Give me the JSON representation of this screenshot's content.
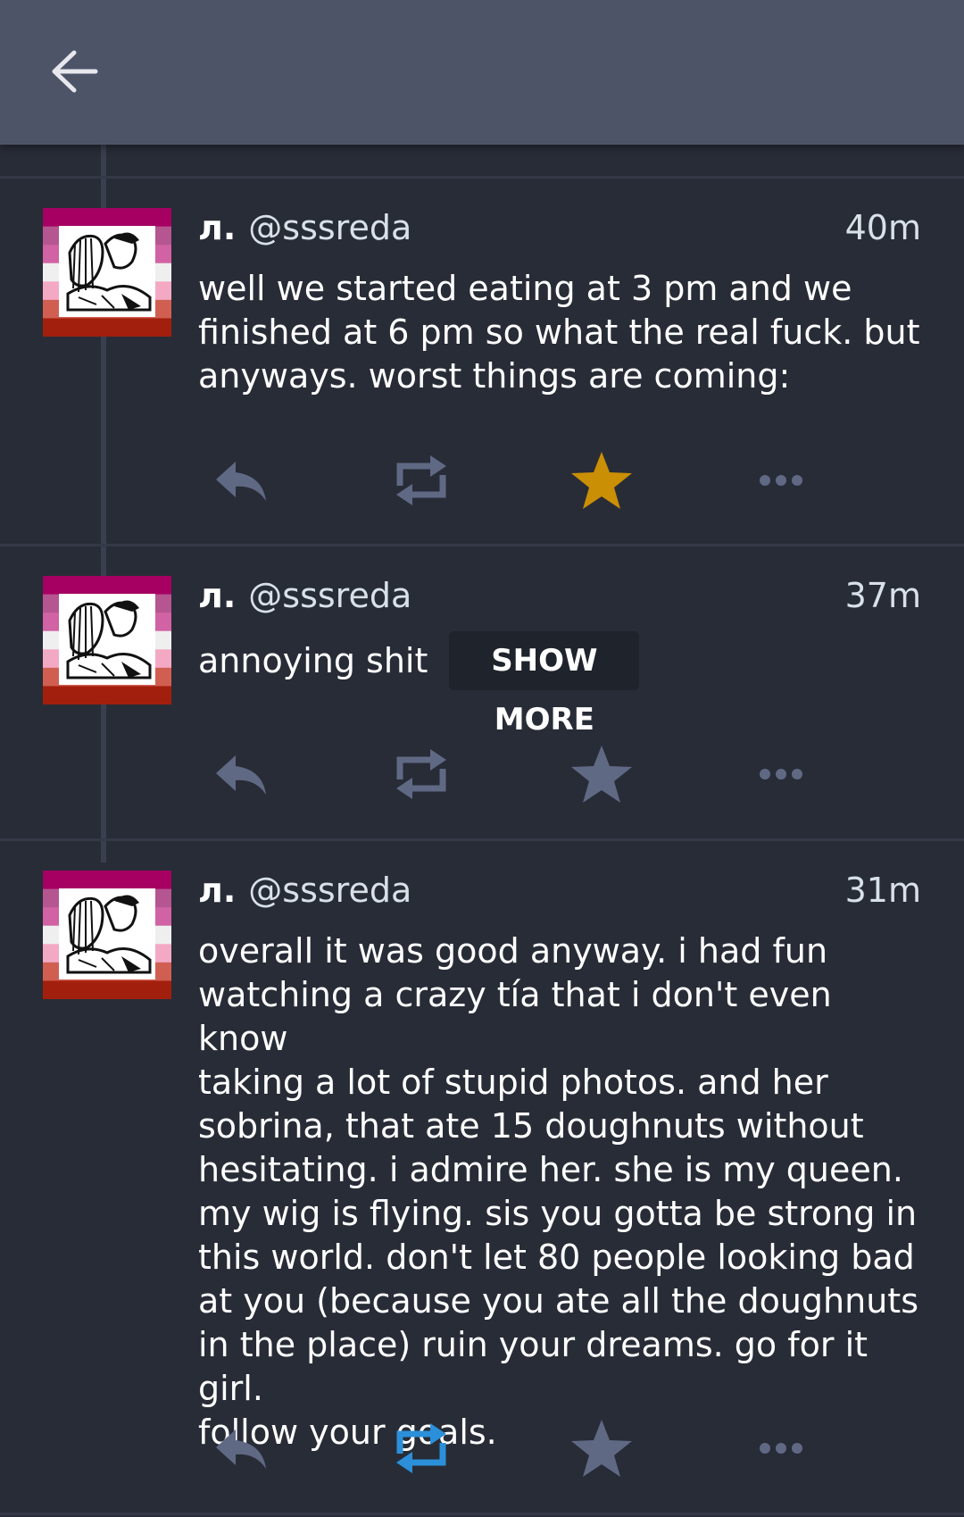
{
  "colors": {
    "background": "#282c37",
    "topbar": "#4e5468",
    "icon_default": "#606984",
    "favourited": "#ca8f04",
    "boosted": "#2b90d9"
  },
  "topbar": {
    "back_icon": "arrow-left-icon"
  },
  "statuses": [
    {
      "display_name": "л.",
      "handle": "@sssreda",
      "time": "40m",
      "content": "well we started eating at 3 pm and we\nfinished at 6 pm so what the real fuck. but\nanyways. worst things are coming:",
      "favourited": true,
      "boosted": false
    },
    {
      "display_name": "л.",
      "handle": "@sssreda",
      "time": "37m",
      "content": "annoying shit",
      "show_more_label": "SHOW MORE",
      "favourited": false,
      "boosted": false
    },
    {
      "display_name": "л.",
      "handle": "@sssreda",
      "time": "31m",
      "content": "overall it was good anyway. i had fun\nwatching a crazy tía that i don't even know\ntaking a lot of stupid photos. and her\nsobrina, that ate 15 doughnuts without\nhesitating. i admire her. she is my queen.\nmy wig is flying. sis you gotta be strong in\nthis world. don't let 80 people looking bad\nat you (because you ate all the doughnuts\nin the place) ruin your dreams. go for it girl.\nfollow your goals.",
      "favourited": false,
      "boosted": true
    }
  ]
}
